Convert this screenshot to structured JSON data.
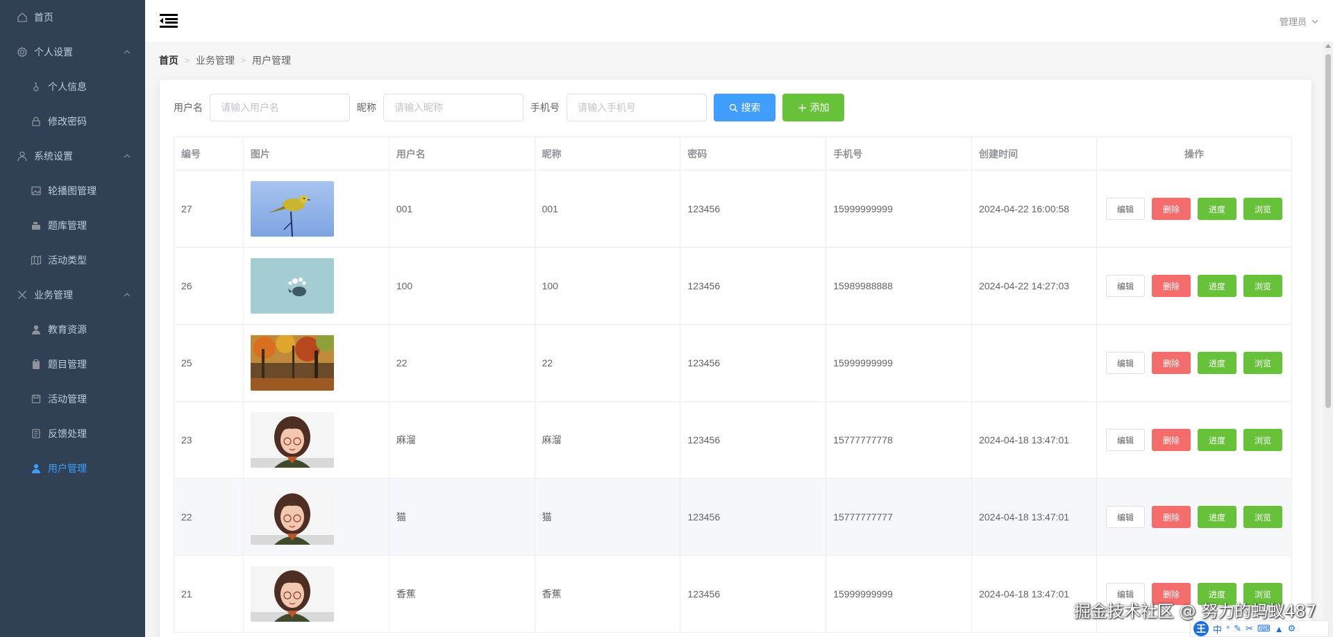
{
  "sidebar": {
    "items": [
      {
        "label": "首页",
        "icon": "home-icon",
        "level": "top"
      },
      {
        "label": "个人设置",
        "icon": "gear-icon",
        "level": "top",
        "expanded": true
      },
      {
        "label": "个人信息",
        "icon": "info-icon",
        "level": "sub"
      },
      {
        "label": "修改密码",
        "icon": "lock-icon",
        "level": "sub"
      },
      {
        "label": "系统设置",
        "icon": "user-icon",
        "level": "top",
        "expanded": true
      },
      {
        "label": "轮播图管理",
        "icon": "picture-icon",
        "level": "sub"
      },
      {
        "label": "题库管理",
        "icon": "box-icon",
        "level": "sub"
      },
      {
        "label": "活动类型",
        "icon": "map-icon",
        "level": "sub"
      },
      {
        "label": "业务管理",
        "icon": "cross-icon",
        "level": "top",
        "expanded": true
      },
      {
        "label": "教育资源",
        "icon": "person-icon",
        "level": "sub"
      },
      {
        "label": "题目管理",
        "icon": "clipboard-icon",
        "level": "sub"
      },
      {
        "label": "活动管理",
        "icon": "save-icon",
        "level": "sub"
      },
      {
        "label": "反馈处理",
        "icon": "document-icon",
        "level": "sub"
      },
      {
        "label": "用户管理",
        "icon": "person-icon",
        "level": "sub",
        "active": true
      }
    ]
  },
  "header": {
    "user": "管理员"
  },
  "breadcrumb": [
    "首页",
    "业务管理",
    "用户管理"
  ],
  "filter": {
    "username_label": "用户名",
    "username_placeholder": "请输入用户名",
    "nickname_label": "昵称",
    "nickname_placeholder": "请输入昵称",
    "phone_label": "手机号",
    "phone_placeholder": "请输入手机号",
    "search_label": "搜索",
    "add_label": "添加"
  },
  "table": {
    "headers": [
      "编号",
      "图片",
      "用户名",
      "昵称",
      "密码",
      "手机号",
      "创建时间",
      "操作"
    ],
    "rows": [
      {
        "id": "27",
        "image": "bird",
        "username": "001",
        "nickname": "001",
        "password": "123456",
        "phone": "15999999999",
        "created": "2024-04-22 16:00:58"
      },
      {
        "id": "26",
        "image": "whale",
        "username": "100",
        "nickname": "100",
        "password": "123456",
        "phone": "15989988888",
        "created": "2024-04-22 14:27:03"
      },
      {
        "id": "25",
        "image": "forest",
        "username": "22",
        "nickname": "22",
        "password": "123456",
        "phone": "15999999999",
        "created": ""
      },
      {
        "id": "23",
        "image": "girl",
        "username": "麻溜",
        "nickname": "麻溜",
        "password": "123456",
        "phone": "15777777778",
        "created": "2024-04-18 13:47:01"
      },
      {
        "id": "22",
        "image": "girl",
        "username": "猫",
        "nickname": "猫",
        "password": "123456",
        "phone": "15777777777",
        "created": "2024-04-18 13:47:01"
      },
      {
        "id": "21",
        "image": "girl",
        "username": "香蕉",
        "nickname": "香蕉",
        "password": "123456",
        "phone": "15999999999",
        "created": "2024-04-18 13:47:01"
      }
    ],
    "ops": {
      "edit": "编辑",
      "delete": "删除",
      "progress": "进度",
      "view": "浏览"
    }
  },
  "watermark": "掘金技术社区 @ 努力的蚂蚁487",
  "ime": {
    "logo": "王",
    "mode": "中"
  },
  "colors": {
    "sidebar_bg": "#304156",
    "primary": "#409eff",
    "success": "#67c23a",
    "danger": "#f56c6c"
  }
}
